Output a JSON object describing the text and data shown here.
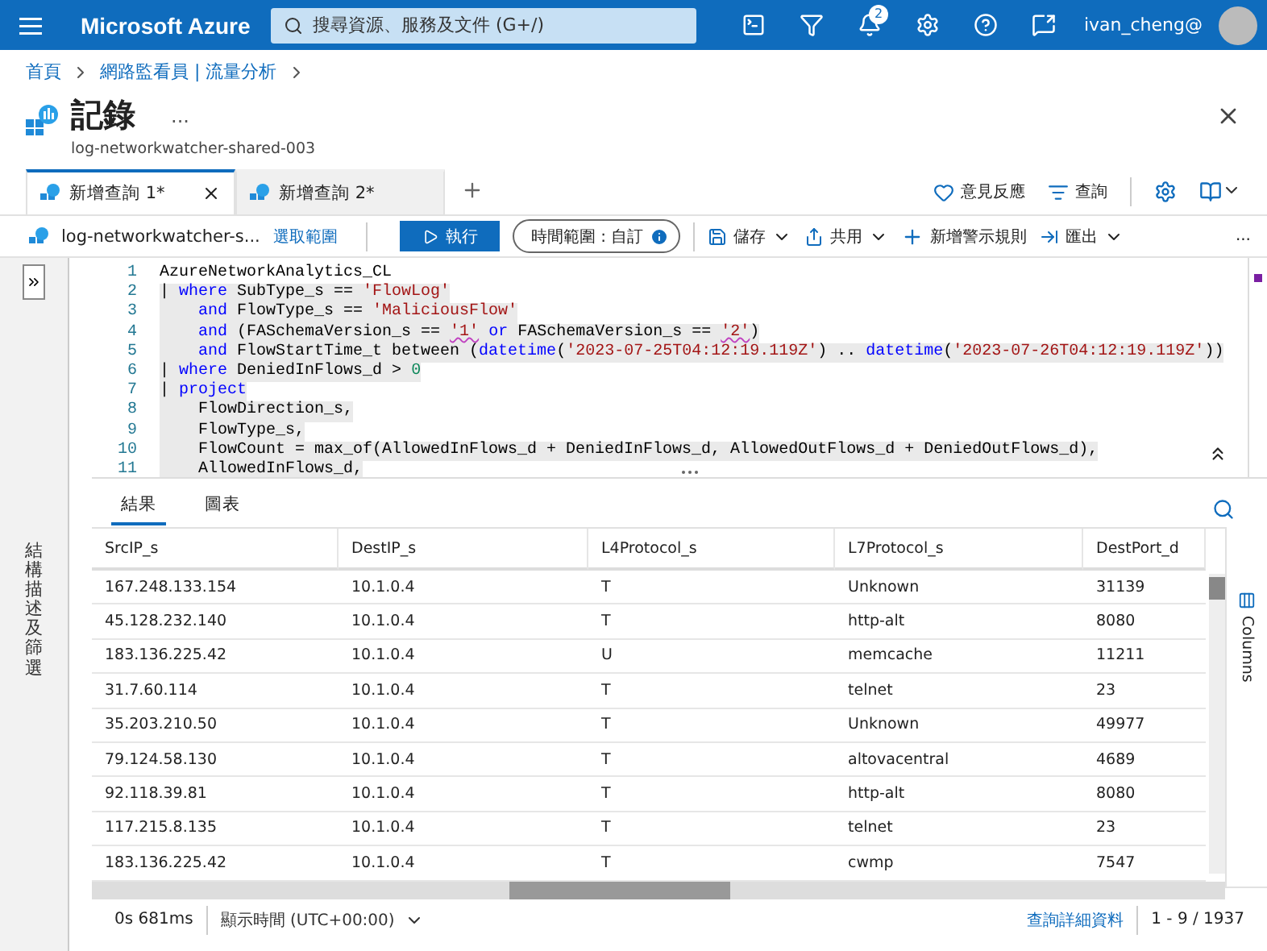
{
  "topbar": {
    "brand": "Microsoft Azure",
    "search": {
      "placeholder": "搜尋資源、服務及文件 (G+/)"
    },
    "notifications": "2",
    "user": "ivan_cheng@"
  },
  "breadcrumb": [
    "首頁",
    "網路監看員 | 流量分析"
  ],
  "blade": {
    "title": "記錄",
    "more": "...",
    "subtitle": "log-networkwatcher-shared-003"
  },
  "query_tabs": [
    {
      "label": "新增查詢 1*",
      "selected": true
    },
    {
      "label": "新增查詢 2*",
      "selected": false
    }
  ],
  "top_actions": [
    "意見反應",
    "查詢"
  ],
  "toolbar": {
    "scope": "log-networkwatcher-s...",
    "select_scope": "選取範圍",
    "run": "執行",
    "time_range": "時間範圍 : 自訂",
    "save": "儲存",
    "share": "共用",
    "new_alert": "新增警示規則",
    "export": "匯出",
    "more": "..."
  },
  "side_panel": {
    "label": "結構描述及篩選"
  },
  "editor": {
    "lines": [
      [
        {
          "kind": "plain",
          "text": "AzureNetworkAnalytics_CL"
        }
      ],
      [
        {
          "kind": "plain",
          "text": "| "
        },
        {
          "kind": "keyword",
          "text": "where"
        },
        {
          "kind": "plain",
          "text": " SubType_s == "
        },
        {
          "kind": "string",
          "text": "'FlowLog'"
        }
      ],
      [
        {
          "kind": "keyword",
          "text": "    and"
        },
        {
          "kind": "plain",
          "text": " FlowType_s == "
        },
        {
          "kind": "string",
          "text": "'MaliciousFlow'"
        }
      ],
      [
        {
          "kind": "keyword",
          "text": "    and"
        },
        {
          "kind": "plain",
          "text": " (FASchemaVersion_s == "
        },
        {
          "kind": "warn-string",
          "text": "'1'"
        },
        {
          "kind": "keyword",
          "text": " or"
        },
        {
          "kind": "plain",
          "text": " FASchemaVersion_s == "
        },
        {
          "kind": "warn-string",
          "text": "'2'"
        },
        {
          "kind": "plain",
          "text": ")"
        }
      ],
      [
        {
          "kind": "keyword",
          "text": "    and"
        },
        {
          "kind": "plain",
          "text": " FlowStartTime_t between ("
        },
        {
          "kind": "function",
          "text": "datetime"
        },
        {
          "kind": "plain",
          "text": "("
        },
        {
          "kind": "string",
          "text": "'2023-07-25T04:12:19.119Z'"
        },
        {
          "kind": "plain",
          "text": ") .. "
        },
        {
          "kind": "function",
          "text": "datetime"
        },
        {
          "kind": "plain",
          "text": "("
        },
        {
          "kind": "string",
          "text": "'2023-07-26T04:12:19.119Z'"
        },
        {
          "kind": "plain",
          "text": "))"
        }
      ],
      [
        {
          "kind": "plain",
          "text": "| "
        },
        {
          "kind": "keyword",
          "text": "where"
        },
        {
          "kind": "plain",
          "text": " DeniedInFlows_d > "
        },
        {
          "kind": "number",
          "text": "0"
        }
      ],
      [
        {
          "kind": "plain",
          "text": "| "
        },
        {
          "kind": "keyword",
          "text": "project"
        }
      ],
      [
        {
          "kind": "plain",
          "text": "    FlowDirection_s,"
        }
      ],
      [
        {
          "kind": "plain",
          "text": "    FlowType_s,"
        }
      ],
      [
        {
          "kind": "plain",
          "text": "    FlowCount = max_of(AllowedInFlows_d + DeniedInFlows_d, AllowedOutFlows_d + DeniedOutFlows_d),"
        }
      ],
      [
        {
          "kind": "plain",
          "text": "    AllowedInFlows_d,"
        }
      ]
    ],
    "line_numbers": [
      "1",
      "2",
      "3",
      "4",
      "5",
      "6",
      "7",
      "8",
      "9",
      "10",
      "11"
    ]
  },
  "result_tabs": [
    {
      "label": "結果",
      "selected": true
    },
    {
      "label": "圖表",
      "selected": false
    }
  ],
  "columns_toggle": "Columns",
  "table": {
    "columns": [
      "SrcIP_s",
      "DestIP_s",
      "L4Protocol_s",
      "L7Protocol_s",
      "DestPort_d"
    ],
    "rows": [
      [
        "167.248.133.154",
        "10.1.0.4",
        "T",
        "Unknown",
        "31139"
      ],
      [
        "45.128.232.140",
        "10.1.0.4",
        "T",
        "http-alt",
        "8080"
      ],
      [
        "183.136.225.42",
        "10.1.0.4",
        "U",
        "memcache",
        "11211"
      ],
      [
        "31.7.60.114",
        "10.1.0.4",
        "T",
        "telnet",
        "23"
      ],
      [
        "35.203.210.50",
        "10.1.0.4",
        "T",
        "Unknown",
        "49977"
      ],
      [
        "79.124.58.130",
        "10.1.0.4",
        "T",
        "altovacentral",
        "4689"
      ],
      [
        "92.118.39.81",
        "10.1.0.4",
        "T",
        "http-alt",
        "8080"
      ],
      [
        "117.215.8.135",
        "10.1.0.4",
        "T",
        "telnet",
        "23"
      ],
      [
        "183.136.225.42",
        "10.1.0.4",
        "T",
        "cwmp",
        "7547"
      ]
    ]
  },
  "status_bar": {
    "duration": "0s 681ms",
    "timezone": "顯示時間 (UTC+00:00)",
    "details": "查詢詳細資料",
    "count": "1 - 9 / 1937"
  }
}
